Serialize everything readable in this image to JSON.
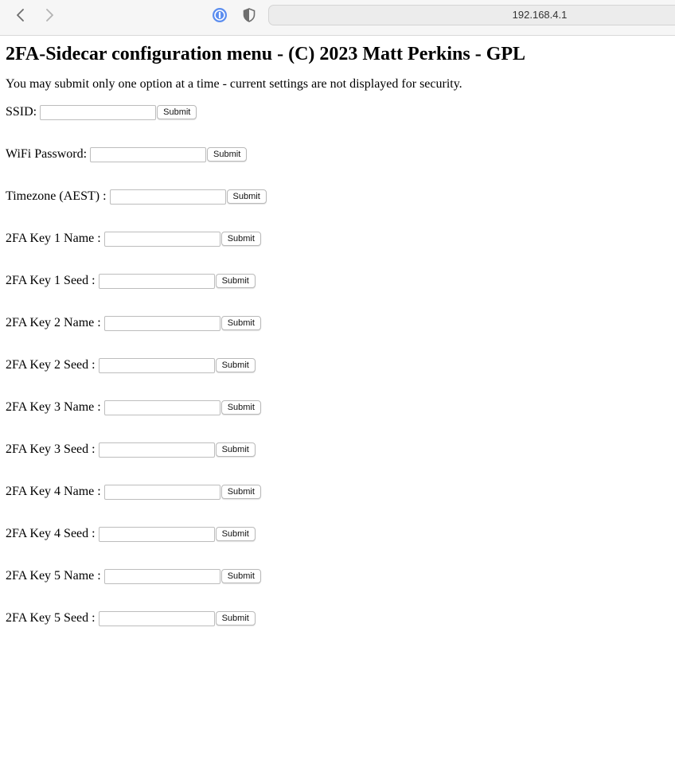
{
  "browser": {
    "url": "192.168.4.1",
    "icons": {
      "back": "chevron-left-icon",
      "forward": "chevron-right-icon",
      "password": "password-manager-icon",
      "privacy": "shield-icon"
    }
  },
  "page": {
    "title": "2FA-Sidecar configuration menu - (C) 2023 Matt Perkins - GPL",
    "note": "You may submit only one option at a time - current settings are not displayed for security."
  },
  "form": {
    "submit_label": "Submit",
    "fields": [
      {
        "label": "SSID:",
        "value": ""
      },
      {
        "label": "WiFi Password:",
        "value": ""
      },
      {
        "label": "Timezone (AEST) :",
        "value": ""
      },
      {
        "label": "2FA Key 1 Name :",
        "value": ""
      },
      {
        "label": "2FA Key 1 Seed :",
        "value": ""
      },
      {
        "label": "2FA Key 2 Name :",
        "value": ""
      },
      {
        "label": "2FA Key 2 Seed :",
        "value": ""
      },
      {
        "label": "2FA Key 3 Name :",
        "value": ""
      },
      {
        "label": "2FA Key 3 Seed :",
        "value": ""
      },
      {
        "label": "2FA Key 4 Name :",
        "value": ""
      },
      {
        "label": "2FA Key 4 Seed :",
        "value": ""
      },
      {
        "label": "2FA Key 5 Name :",
        "value": ""
      },
      {
        "label": "2FA Key 5 Seed :",
        "value": ""
      }
    ]
  }
}
